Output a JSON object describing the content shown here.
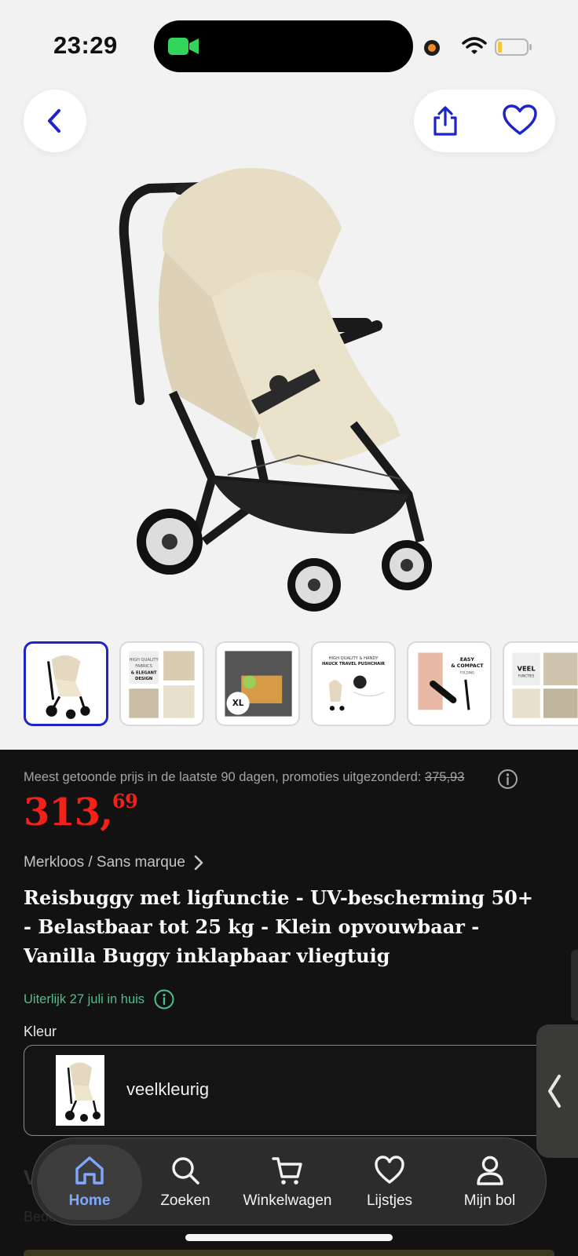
{
  "status_bar": {
    "time": "23:29"
  },
  "gallery": {
    "thumbnails": [
      {
        "caption": ""
      },
      {
        "caption": "HIGH QUALITY FABRICS & ELEGANT DESIGN"
      },
      {
        "caption": "XL BASKET"
      },
      {
        "caption": "HIGH QUALITY & HANDY HAUCK TRAVEL PUSHCHAIR"
      },
      {
        "caption": "EASY & COMPACT FOLDING"
      },
      {
        "caption": "VEEL FUNCTIES"
      }
    ]
  },
  "pricing": {
    "note_prefix": "Meest getoonde prijs in de laatste 90 dagen, promoties uitgezonderd:",
    "old_price": "375,93",
    "price_main": "313,",
    "price_cents": "69"
  },
  "product": {
    "brand": "Merkloos / Sans marque",
    "title": "Reisbuggy met ligfunctie - UV-bescherming 50+ - Belastbaar tot 25 kg - Klein opvouwbaar - Vanilla Buggy inklapbaar vliegtuig",
    "delivery": "Uiterlijk 27 juli in huis",
    "color_label": "Kleur",
    "color_value": "veelkleurig"
  },
  "faded": {
    "v": "V",
    "b": "Beoo"
  },
  "tabbar": {
    "items": [
      {
        "label": "Home",
        "icon": "home-icon",
        "active": true
      },
      {
        "label": "Zoeken",
        "icon": "search-icon"
      },
      {
        "label": "Winkelwagen",
        "icon": "cart-icon"
      },
      {
        "label": "Lijstjes",
        "icon": "heart-icon"
      },
      {
        "label": "Mijn bol",
        "icon": "user-icon"
      }
    ]
  },
  "colors": {
    "price_red": "#f4201a",
    "accent_blue": "#1d24c8",
    "delivery_green": "#4fbf8a",
    "tab_active": "#7fa8ff"
  }
}
